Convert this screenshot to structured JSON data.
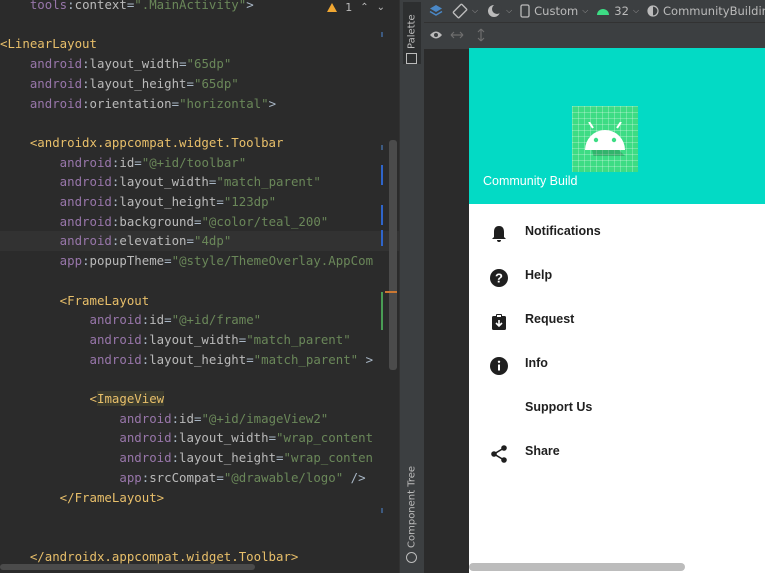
{
  "editor": {
    "lines": [
      [
        [
          "ns",
          "    tools"
        ],
        [
          "punc",
          ":"
        ],
        [
          "attr",
          "context"
        ],
        [
          "punc",
          "="
        ],
        [
          "val",
          "\".MainActivity\""
        ],
        [
          "punc",
          ">"
        ]
      ],
      [],
      [
        [
          "tag",
          "<LinearLayout"
        ]
      ],
      [
        [
          "ns",
          "    android"
        ],
        [
          "punc",
          ":"
        ],
        [
          "attr",
          "layout_width"
        ],
        [
          "punc",
          "="
        ],
        [
          "val",
          "\"65dp\""
        ]
      ],
      [
        [
          "ns",
          "    android"
        ],
        [
          "punc",
          ":"
        ],
        [
          "attr",
          "layout_height"
        ],
        [
          "punc",
          "="
        ],
        [
          "val",
          "\"65dp\""
        ]
      ],
      [
        [
          "ns",
          "    android"
        ],
        [
          "punc",
          ":"
        ],
        [
          "attr",
          "orientation"
        ],
        [
          "punc",
          "="
        ],
        [
          "val",
          "\"horizontal\""
        ],
        [
          "punc",
          ">"
        ]
      ],
      [],
      [
        [
          "tag",
          "    <androidx.appcompat.widget.Toolbar"
        ]
      ],
      [
        [
          "ns",
          "        android"
        ],
        [
          "punc",
          ":"
        ],
        [
          "attr",
          "id"
        ],
        [
          "punc",
          "="
        ],
        [
          "val",
          "\"@+id/toolbar\""
        ]
      ],
      [
        [
          "ns",
          "        android"
        ],
        [
          "punc",
          ":"
        ],
        [
          "attr",
          "layout_width"
        ],
        [
          "punc",
          "="
        ],
        [
          "val",
          "\"match_parent\""
        ]
      ],
      [
        [
          "ns",
          "        android"
        ],
        [
          "punc",
          ":"
        ],
        [
          "attr",
          "layout_height"
        ],
        [
          "punc",
          "="
        ],
        [
          "val",
          "\"123dp\""
        ]
      ],
      [
        [
          "ns",
          "        android"
        ],
        [
          "punc",
          ":"
        ],
        [
          "attr",
          "background"
        ],
        [
          "punc",
          "="
        ],
        [
          "val",
          "\"@color/teal_200\""
        ]
      ],
      [
        [
          "ns",
          "        android"
        ],
        [
          "punc",
          ":"
        ],
        [
          "attr",
          "elevation"
        ],
        [
          "punc",
          "="
        ],
        [
          "val",
          "\"4dp\""
        ]
      ],
      [
        [
          "ns",
          "        app"
        ],
        [
          "punc",
          ":"
        ],
        [
          "attr",
          "popupTheme"
        ],
        [
          "punc",
          "="
        ],
        [
          "val",
          "\"@style/ThemeOverlay.AppCom"
        ]
      ],
      [],
      [
        [
          "tag",
          "        <FrameLayout"
        ]
      ],
      [
        [
          "ns",
          "            android"
        ],
        [
          "punc",
          ":"
        ],
        [
          "attr",
          "id"
        ],
        [
          "punc",
          "="
        ],
        [
          "val",
          "\"@+id/frame\""
        ]
      ],
      [
        [
          "ns",
          "            android"
        ],
        [
          "punc",
          ":"
        ],
        [
          "attr",
          "layout_width"
        ],
        [
          "punc",
          "="
        ],
        [
          "val",
          "\"match_parent\""
        ]
      ],
      [
        [
          "ns",
          "            android"
        ],
        [
          "punc",
          ":"
        ],
        [
          "attr",
          "layout_height"
        ],
        [
          "punc",
          "="
        ],
        [
          "val",
          "\"match_parent\""
        ],
        [
          "punc",
          " >"
        ]
      ],
      [],
      [
        [
          "tag",
          "            <"
        ],
        [
          "hl",
          "ImageView"
        ]
      ],
      [
        [
          "ns",
          "                android"
        ],
        [
          "punc",
          ":"
        ],
        [
          "attr",
          "id"
        ],
        [
          "punc",
          "="
        ],
        [
          "val",
          "\"@+id/imageView2\""
        ]
      ],
      [
        [
          "ns",
          "                android"
        ],
        [
          "punc",
          ":"
        ],
        [
          "attr",
          "layout_width"
        ],
        [
          "punc",
          "="
        ],
        [
          "val",
          "\"wrap_content"
        ]
      ],
      [
        [
          "ns",
          "                android"
        ],
        [
          "punc",
          ":"
        ],
        [
          "attr",
          "layout_height"
        ],
        [
          "punc",
          "="
        ],
        [
          "val",
          "\"wrap_conten"
        ]
      ],
      [
        [
          "ns",
          "                app"
        ],
        [
          "punc",
          ":"
        ],
        [
          "attr",
          "srcCompat"
        ],
        [
          "punc",
          "="
        ],
        [
          "val",
          "\"@drawable/logo\""
        ],
        [
          "punc",
          " />"
        ]
      ],
      [
        [
          "tag",
          "        </FrameLayout>"
        ]
      ],
      [],
      [],
      [
        [
          "tag",
          "    </androidx.appcompat.widget.Toolbar>"
        ]
      ]
    ],
    "inspection_count": "1"
  },
  "side_tabs": {
    "palette": "Palette",
    "component_tree": "Component Tree"
  },
  "designer_toolbar": {
    "device": "Custom",
    "api_level": "32",
    "theme": "CommunityBuilding"
  },
  "app": {
    "header_title": "Community Build",
    "header_color": "#03dac5",
    "menu": [
      {
        "label": "Notifications",
        "icon": "bell-icon"
      },
      {
        "label": "Help",
        "icon": "help-icon"
      },
      {
        "label": "Request",
        "icon": "request-icon"
      },
      {
        "label": "Info",
        "icon": "info-icon"
      },
      {
        "label": "Support Us",
        "icon": ""
      },
      {
        "label": "Share",
        "icon": "share-icon"
      }
    ]
  },
  "colors": {
    "editor_bg": "#2b2b2b",
    "teal": "#03dac5",
    "android_green": "#3ddc84"
  }
}
